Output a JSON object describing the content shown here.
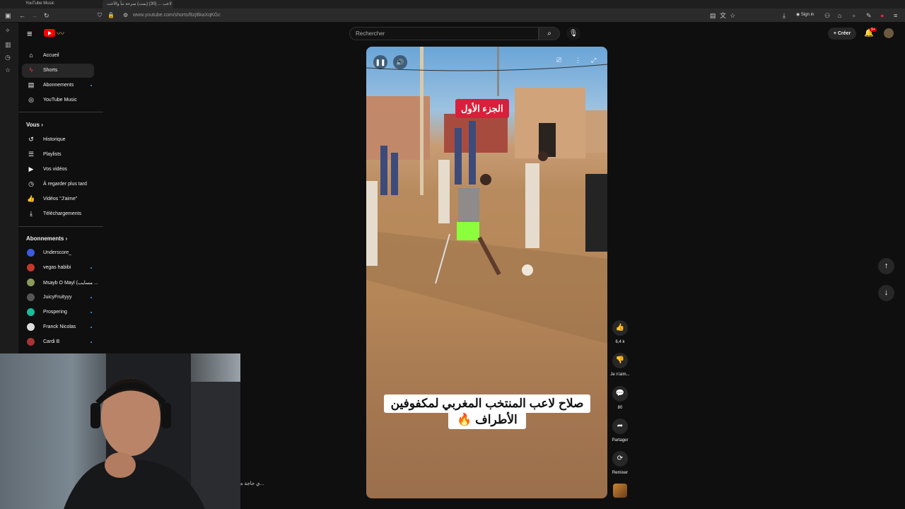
{
  "browser": {
    "tabs": [
      {
        "title": "YouTube Music"
      },
      {
        "title": "لاعب ... (30) (بمت) سرحة نبأ والأخت"
      }
    ],
    "url": "www.youtube.com/shorts/BzjBkaXqKGc",
    "sign_in_label": "Sign in"
  },
  "header": {
    "search_placeholder": "Rechercher",
    "create_label": "Créer",
    "notification_count": "9+"
  },
  "nav": {
    "main": [
      {
        "label": "Accueil",
        "icon": "home-icon"
      },
      {
        "label": "Shorts",
        "icon": "shorts-icon",
        "active": true
      },
      {
        "label": "Abonnements",
        "icon": "subscriptions-icon"
      },
      {
        "label": "YouTube Music",
        "icon": "music-icon"
      }
    ],
    "you_heading": "Vous",
    "you": [
      {
        "label": "Historique",
        "icon": "history-icon"
      },
      {
        "label": "Playlists",
        "icon": "playlist-icon"
      },
      {
        "label": "Vos vidéos",
        "icon": "video-icon"
      },
      {
        "label": "À regarder plus tard",
        "icon": "clock-icon"
      },
      {
        "label": "Vidéos \"J'aime\"",
        "icon": "like-icon"
      },
      {
        "label": "Téléchargements",
        "icon": "download-icon"
      }
    ],
    "subs_heading": "Abonnements",
    "subs": [
      {
        "label": "Underscore_",
        "color": "#3b5bdb"
      },
      {
        "label": "vegas habibi",
        "color": "#c0392b"
      },
      {
        "label": "Msayb O Mayl (مسايب ...",
        "color": "#8a9a5b"
      },
      {
        "label": "JuicyFruityyy",
        "color": "#555555"
      },
      {
        "label": "Prospering",
        "color": "#1abc9c"
      },
      {
        "label": "Franck Nicolas",
        "color": "#222222"
      },
      {
        "label": "Cardi B",
        "color": "#a33"
      }
    ]
  },
  "video": {
    "badge": "الجزء الأول",
    "caption_line1": "صلاح لاعب المنتخب المغربي لمكفوفين",
    "caption_line2": "الأطراف 🔥"
  },
  "actions": {
    "likes": "6,4 k",
    "dislike_label": "Je n'aim...",
    "comments": "80",
    "share_label": "Partager",
    "remix_label": "Remixer"
  },
  "overlay": {
    "chat_text": "...ي حاجة ه"
  }
}
